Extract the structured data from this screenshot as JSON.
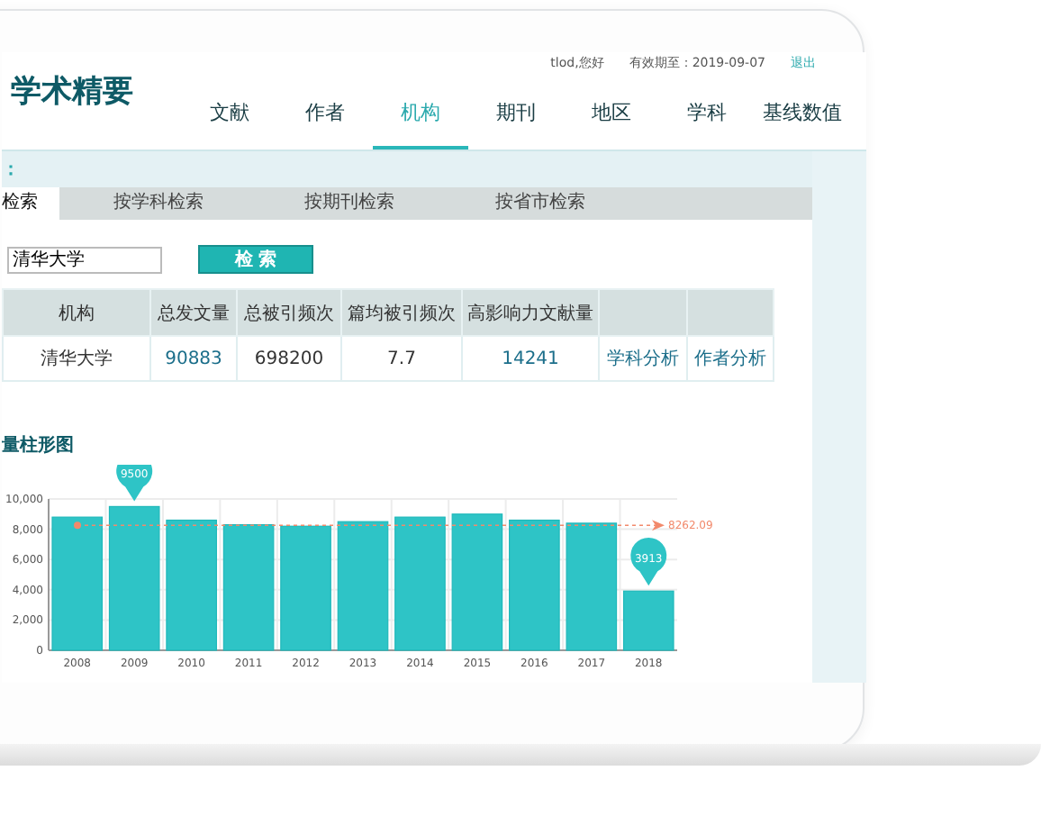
{
  "header": {
    "logo": "学术精要",
    "greeting": "tlod,您好",
    "expiry": "有效期至：2019-09-07",
    "logout": "退出"
  },
  "nav": [
    {
      "label": "文献",
      "selected": false
    },
    {
      "label": "作者",
      "selected": false
    },
    {
      "label": "机构",
      "selected": true
    },
    {
      "label": "期刊",
      "selected": false
    },
    {
      "label": "地区",
      "selected": false
    },
    {
      "label": "学科",
      "selected": false
    },
    {
      "label": "基线数值",
      "selected": false
    }
  ],
  "section_label": "：",
  "search_tabs": [
    {
      "label": "检索",
      "selected": true
    },
    {
      "label": "按学科检索",
      "selected": false
    },
    {
      "label": "按期刊检索",
      "selected": false
    },
    {
      "label": "按省市检索",
      "selected": false
    }
  ],
  "search": {
    "value": "清华大学",
    "button": "检 索"
  },
  "table": {
    "columns": [
      "机构",
      "总发文量",
      "总被引频次",
      "篇均被引频次",
      "高影响力文献量"
    ],
    "rows": [
      {
        "cells": [
          {
            "text": "清华大学",
            "kind": "plain"
          },
          {
            "text": "90883",
            "kind": "link"
          },
          {
            "text": "698200",
            "kind": "plain"
          },
          {
            "text": "7.7",
            "kind": "plain"
          },
          {
            "text": "14241",
            "kind": "link"
          },
          {
            "text": "学科分析",
            "kind": "link"
          },
          {
            "text": "作者分析",
            "kind": "link"
          }
        ]
      }
    ]
  },
  "chart_section": {
    "title": "量柱形图",
    "chart_data": {
      "type": "bar",
      "categories": [
        "2008",
        "2009",
        "2010",
        "2011",
        "2012",
        "2013",
        "2014",
        "2015",
        "2016",
        "2017",
        "2018"
      ],
      "series": [
        {
          "color": "#2ec4c6",
          "values": [
            8800,
            9500,
            8600,
            8300,
            8200,
            8500,
            8800,
            9000,
            8600,
            8400,
            3913
          ]
        }
      ],
      "grid": true,
      "ylim": [
        0,
        10000
      ],
      "yticks": [
        {
          "value": 0,
          "label": "0"
        },
        {
          "value": 2000,
          "label": "2,000"
        },
        {
          "value": 4000,
          "label": "4,000"
        },
        {
          "value": 6000,
          "label": "6,000"
        },
        {
          "value": 8000,
          "label": "8,000"
        },
        {
          "value": 10000,
          "label": "10,000"
        }
      ],
      "ref_lines": [
        {
          "axis": "y",
          "value": 8262.09,
          "label": "8262.09"
        }
      ],
      "annotations": [
        {
          "text": "9500",
          "x": "2009",
          "y": 9500
        },
        {
          "text": "3913",
          "x": "2018",
          "y": 3913
        }
      ]
    }
  }
}
